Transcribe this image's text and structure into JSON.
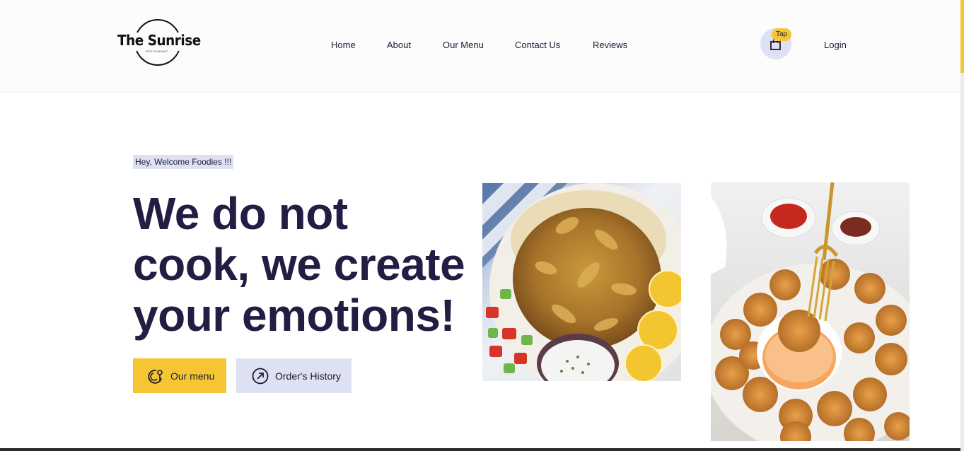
{
  "logo": {
    "name": "The Sunrise",
    "sub": "RESTAURANT"
  },
  "nav": {
    "items": [
      {
        "label": "Home"
      },
      {
        "label": "About"
      },
      {
        "label": "Our Menu"
      },
      {
        "label": "Contact Us"
      },
      {
        "label": "Reviews"
      }
    ]
  },
  "cart": {
    "badge": "Tap",
    "icon": "shopping-bag-icon"
  },
  "login": {
    "label": "Login"
  },
  "hero": {
    "tagline": "Hey, Welcome Foodies !!!",
    "headline_line1": "We do not",
    "headline_line2": "cook, we create",
    "headline_line3": "your emotions!",
    "menu_button": "Our menu",
    "history_button": "Order's History"
  },
  "colors": {
    "accent": "#f5c533",
    "secondary": "#dde1f2",
    "text_dark": "#221d42"
  }
}
